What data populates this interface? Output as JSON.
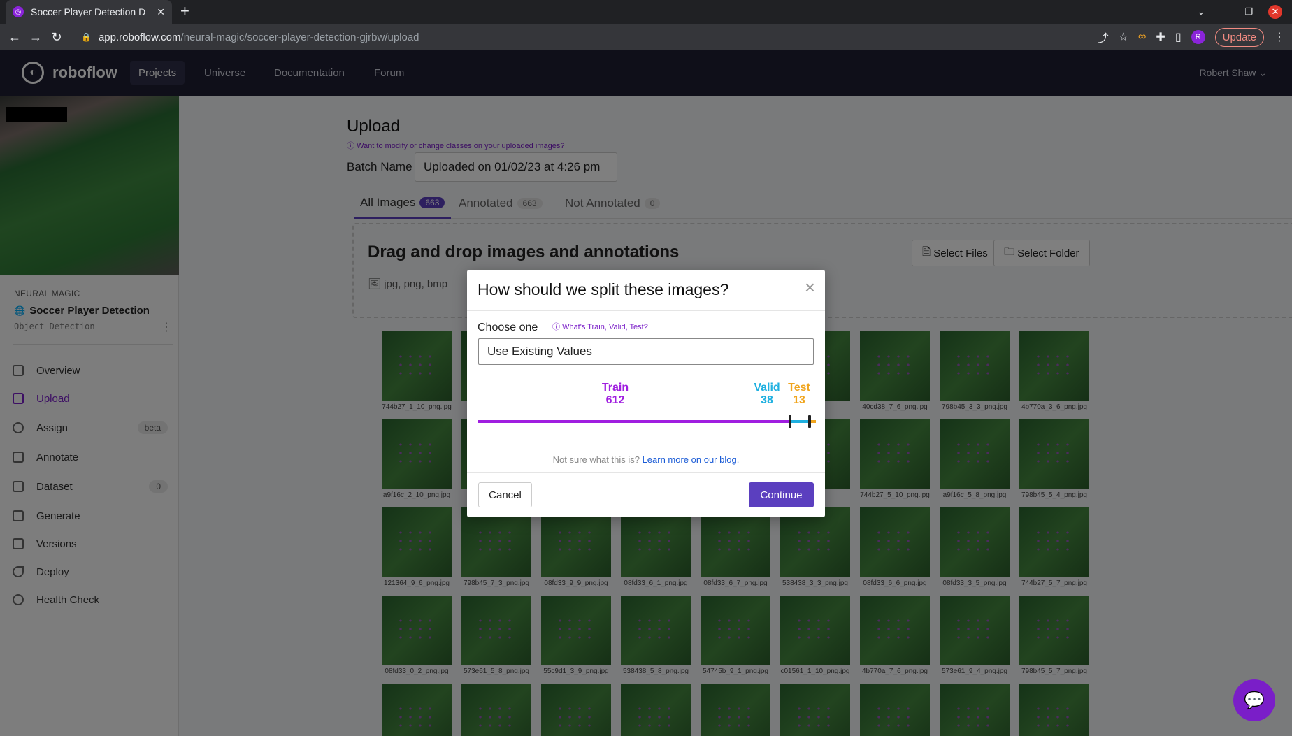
{
  "browser": {
    "tab_title": "Soccer Player Detection D",
    "tab_close": "✕",
    "new_tab": "+",
    "url_host": "app.roboflow.com",
    "url_path": "/neural-magic/soccer-player-detection-gjrbw/upload",
    "profile_initial": "R",
    "update_label": "Update"
  },
  "nav": {
    "logo": "roboflow",
    "projects": "Projects",
    "universe": "Universe",
    "documentation": "Documentation",
    "forum": "Forum",
    "user": "Robert Shaw"
  },
  "sidebar": {
    "workspace": "NEURAL MAGIC",
    "project_name": "Soccer Player Detection",
    "project_type": "Object Detection",
    "items": [
      {
        "label": "Overview"
      },
      {
        "label": "Upload"
      },
      {
        "label": "Assign",
        "badge": "beta"
      },
      {
        "label": "Annotate"
      },
      {
        "label": "Dataset",
        "badge": "0"
      },
      {
        "label": "Generate"
      },
      {
        "label": "Versions"
      },
      {
        "label": "Deploy"
      },
      {
        "label": "Health Check"
      }
    ]
  },
  "upload": {
    "title": "Upload",
    "help": "Want to modify or change classes on your uploaded images?",
    "batch_label": "Batch Name",
    "batch_value": "Uploaded on 01/02/23 at 4:26 pm",
    "tabs": [
      {
        "label": "All Images",
        "count": "663"
      },
      {
        "label": "Annotated",
        "count": "663"
      },
      {
        "label": "Not Annotated",
        "count": "0"
      }
    ],
    "dropzone_title": "Drag and drop images and annotations",
    "dropzone_types": "jpg, png, bmp",
    "select_files": "Select Files",
    "select_folder": "Select Folder",
    "images": [
      "744b27_1_10_png.jpg",
      "",
      "",
      "",
      "",
      "",
      "40cd38_7_6_png.jpg",
      "798b45_3_3_png.jpg",
      "4b770a_3_6_png.jpg",
      "a9f16c_2_10_png.jpg",
      "",
      "",
      "",
      "",
      "",
      "744b27_5_10_png.jpg",
      "a9f16c_5_8_png.jpg",
      "798b45_5_4_png.jpg",
      "121364_9_6_png.jpg",
      "798b45_7_3_png.jpg",
      "08fd33_9_9_png.jpg",
      "08fd33_6_1_png.jpg",
      "08fd33_6_7_png.jpg",
      "538438_3_3_png.jpg",
      "08fd33_6_6_png.jpg",
      "08fd33_3_5_png.jpg",
      "744b27_5_7_png.jpg",
      "08fd33_0_2_png.jpg",
      "573e61_5_8_png.jpg",
      "55c9d1_3_9_png.jpg",
      "538438_5_8_png.jpg",
      "54745b_9_1_png.jpg",
      "c01561_1_10_png.jpg",
      "4b770a_7_6_png.jpg",
      "573e61_9_4_png.jpg",
      "798b45_5_7_png.jpg",
      "",
      "",
      "",
      "",
      "",
      "",
      "",
      "",
      ""
    ]
  },
  "modal": {
    "title": "How should we split these images?",
    "close": "×",
    "choose_label": "Choose one",
    "help_link": "What's Train, Valid, Test?",
    "select_value": "Use Existing Values",
    "split": {
      "train_label": "Train",
      "train": 612,
      "valid_label": "Valid",
      "valid": 38,
      "test_label": "Test",
      "test": 13,
      "train_color": "#a01ee0",
      "valid_color": "#1fb0e0",
      "test_color": "#f0a51e"
    },
    "note_prefix": "Not sure what this is?",
    "note_link": "Learn more on our blog.",
    "cancel": "Cancel",
    "continue": "Continue"
  }
}
